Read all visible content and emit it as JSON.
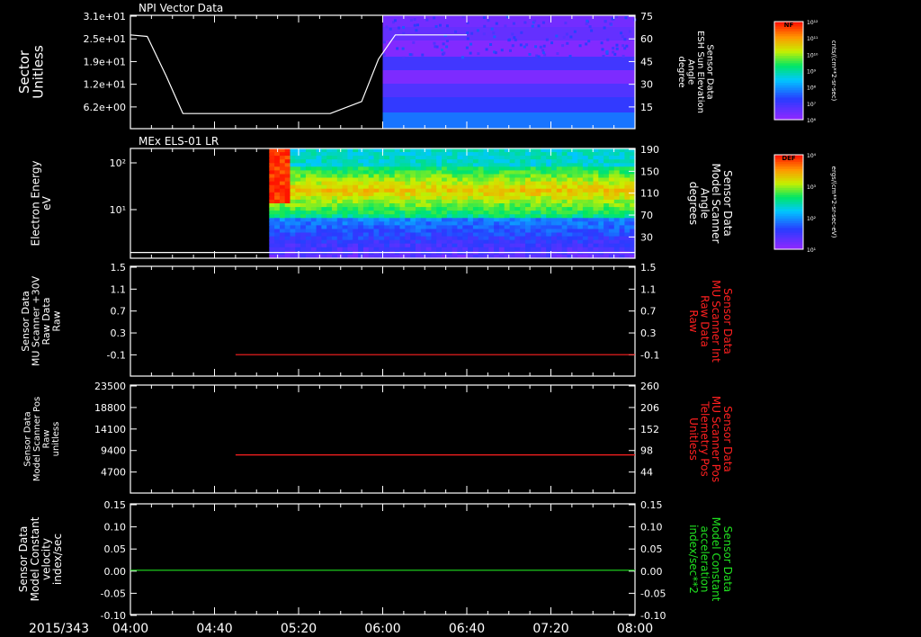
{
  "date_label": "2015/343",
  "colors": {
    "axis": "#ffffff",
    "red_trace": "#ff2020",
    "green_trace": "#20e020",
    "white_trace": "#ffffff"
  },
  "time_ticks": [
    "04:00",
    "04:40",
    "05:20",
    "06:00",
    "06:40",
    "07:20",
    "08:00"
  ],
  "chart_data": [
    {
      "type": "heatmap",
      "title": "NPI Vector Data",
      "ylabel_left": [
        "Sector",
        "Unitless"
      ],
      "yticks_left": [
        "3.1e+01",
        "2.5e+01",
        "1.9e+01",
        "1.2e+01",
        "6.2e+00"
      ],
      "ylabel_right": [
        "Sensor Data",
        "ESH Sun Elevation",
        "Angle",
        "degree"
      ],
      "yticks_right": [
        "75",
        "60",
        "45",
        "30",
        "15"
      ],
      "ylim_right": [
        0,
        75
      ],
      "colorbar": {
        "label": "NF",
        "unit": "cnts/(cm**2-sr-sec)",
        "ticks": [
          "10¹²",
          "10¹¹",
          "10¹⁰",
          "10⁹",
          "10⁸",
          "10⁷",
          "10⁶"
        ]
      },
      "overlay_line": {
        "x": [
          "04:00",
          "04:08",
          "04:17",
          "04:25",
          "05:35",
          "05:50",
          "05:58",
          "06:06",
          "06:40"
        ],
        "y": [
          62,
          61,
          35,
          10,
          10,
          18,
          46,
          62,
          62
        ]
      }
    },
    {
      "type": "heatmap",
      "title": "MEx ELS-01 LR",
      "ylabel_left": [
        "Electron Energy",
        "eV"
      ],
      "yticks_left": [
        "10²",
        "10¹"
      ],
      "ylabel_right": [
        "Sensor Data",
        "Model Scanner",
        "Angle",
        "degrees"
      ],
      "yticks_right": [
        "190",
        "150",
        "110",
        "70",
        "30"
      ],
      "ylim_right": [
        0,
        190
      ],
      "colorbar": {
        "label": "DEF",
        "unit": "ergs/(cm**2-sr-sec-eV)",
        "ticks": [
          "10⁴",
          "10³",
          "10²",
          "10¹"
        ]
      },
      "overlay_line": {
        "x": [
          "04:00",
          "08:00"
        ],
        "y": [
          10,
          10
        ]
      }
    },
    {
      "type": "line",
      "ylabel_left": [
        "Sensor Data",
        "MU Scanner +30V",
        "Raw Data",
        "Raw"
      ],
      "yticks_left": [
        "1.5",
        "1.1",
        "0.7",
        "0.3",
        "-0.1"
      ],
      "ylim_left": [
        -0.4,
        1.5
      ],
      "ylabel_right": [
        "Sensor Data",
        "MU Scanner Int",
        "Raw Data",
        "Raw"
      ],
      "yticks_right": [
        "1.5",
        "1.1",
        "0.7",
        "0.3",
        "-0.1"
      ],
      "series": [
        {
          "x": [
            "04:50",
            "08:00"
          ],
          "y": [
            -0.03,
            -0.03
          ]
        }
      ]
    },
    {
      "type": "line",
      "ylabel_left": [
        "Sensor Data",
        "Model Scanner Pos",
        "Raw",
        "unitless"
      ],
      "yticks_left": [
        "23500",
        "18800",
        "14100",
        "9400",
        "4700"
      ],
      "ylim_left": [
        0,
        23500
      ],
      "ylabel_right": [
        "Sensor Data",
        "MU Scanner Pos",
        "Telemetry Pos",
        "Unitless"
      ],
      "yticks_right": [
        "260",
        "206",
        "152",
        "98",
        "44"
      ],
      "series": [
        {
          "x": [
            "04:50",
            "08:00"
          ],
          "y": [
            8300,
            8300
          ]
        }
      ]
    },
    {
      "type": "line",
      "ylabel_left": [
        "Sensor Data",
        "Model Constant",
        "velocity",
        "index/sec"
      ],
      "yticks_left": [
        "0.15",
        "0.10",
        "0.05",
        "0.00",
        "-0.05",
        "-0.10"
      ],
      "ylim_left": [
        -0.1,
        0.15
      ],
      "ylabel_right": [
        "Sensor Data",
        "Model Constant",
        "acceleration",
        "index/sec**2"
      ],
      "yticks_right": [
        "0.15",
        "0.10",
        "0.05",
        "0.00",
        "-0.05",
        "-0.10"
      ],
      "series": [
        {
          "x": [
            "04:00",
            "08:00"
          ],
          "y": [
            0.0,
            0.0
          ]
        }
      ]
    }
  ]
}
